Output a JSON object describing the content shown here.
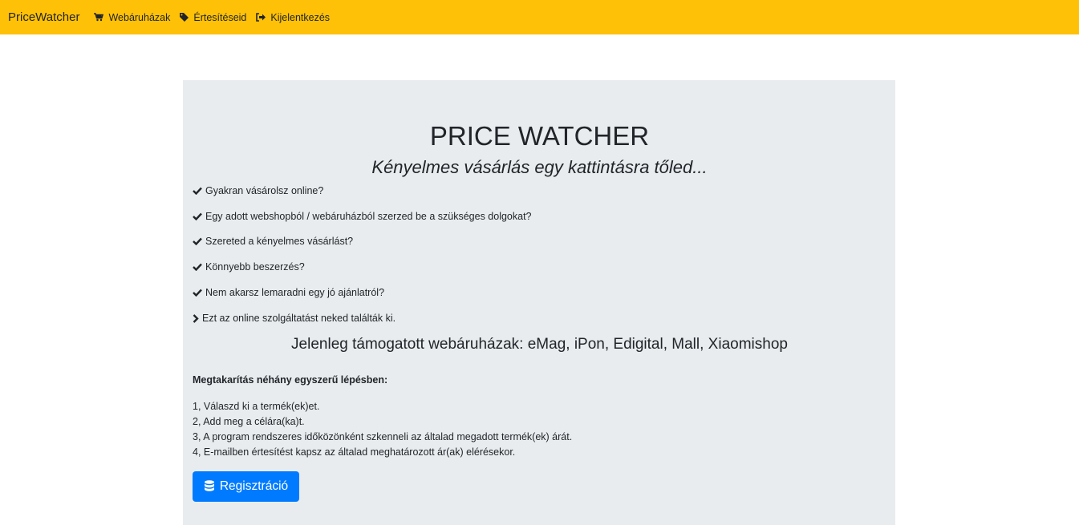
{
  "nav": {
    "brand": "PriceWatcher",
    "items": [
      {
        "label": "Webáruházak",
        "icon": "cart-icon"
      },
      {
        "label": "Értesítéseid",
        "icon": "tag-icon"
      },
      {
        "label": "Kijelentkezés",
        "icon": "sign-out-icon"
      }
    ]
  },
  "hero": {
    "title": "PRICE WATCHER",
    "subtitle": "Kényelmes vásárlás egy kattintásra tőled...",
    "features": [
      "Gyakran vásárolsz online?",
      "Egy adott webshopból / webáruházból szerzed be a szükséges dolgokat?",
      "Szereted a kényelmes vásárlást?",
      "Könnyebb beszerzés?",
      "Nem akarsz lemaradni egy jó ajánlatról?"
    ],
    "conclusion": "Ezt az online szolgáltatást neked találták ki.",
    "supported": "Jelenleg támogatott webáruházak: eMag, iPon, Edigital, Mall, Xiaomishop",
    "steps_title": "Megtakarítás néhány egyszerű lépésben:",
    "steps": [
      "1, Válaszd ki a termék(ek)et.",
      "2, Add meg a célára(ka)t.",
      "3, A program rendszeres időközönként szkenneli az általad megadott termék(ek) árát.",
      "4, E-mailben értesítést kapsz az általad meghatározott ár(ak) elérésekor."
    ],
    "register_label": "Regisztráció"
  },
  "colors": {
    "navbar": "#ffc107",
    "jumbotron": "#e9ecef",
    "primary_button": "#007bff"
  }
}
